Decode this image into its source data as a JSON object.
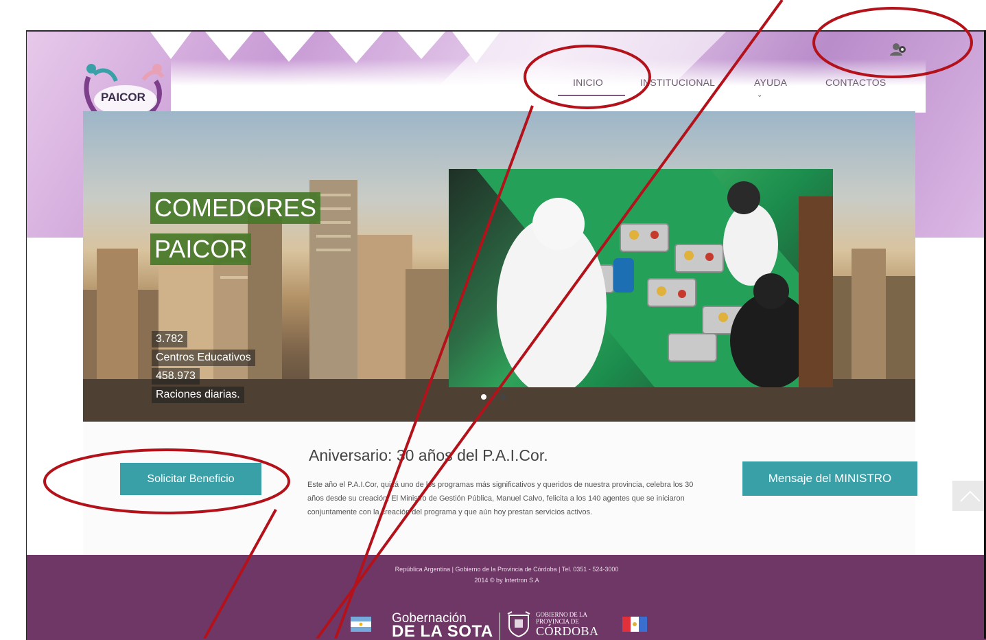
{
  "header": {
    "logo_text": "PAICOR",
    "nav": [
      "INICIO",
      "INSTITUCIONAL",
      "AYUDA",
      "CONTACTOS"
    ],
    "ayuda_chevron": "chevron-down-icon",
    "user_icon": "user-icon"
  },
  "hero": {
    "title_lines": [
      "COMEDORES",
      "PAICOR"
    ],
    "stats": [
      "3.782",
      "Centros Educativos",
      "458.973",
      "Raciones diarias."
    ],
    "slides_count": 3,
    "active_slide": 1
  },
  "content": {
    "solicitar_label": "Solicitar Beneficio",
    "ministro_label": "Mensaje del MINISTRO",
    "news_title": "Aniversario: 30 años del P.A.I.Cor.",
    "news_body": "Este año el P.A.I.Cor, quizá uno de los programas más significativos y queridos de nuestra provincia, celebra los 30 años desde su creación. El Ministro de Gestión Pública, Manuel Calvo, felicita a los 140 agentes que se iniciaron conjuntamente con la creación del programa y que aún hoy prestan servicios activos."
  },
  "footer": {
    "line1": "República Argentina | Gobierno de la Provincia de Córdoba | Tel. 0351 - 524-3000",
    "line2": "2014 © by Intertron S.A",
    "gob_small": "Gobernación",
    "gob_big": "DE LA SOTA",
    "cba_1": "GOBIERNO DE LA",
    "cba_2": "PROVINCIA DE",
    "cba_3": "CÓRDOBA"
  },
  "colors": {
    "teal_button": "#3aa0a8",
    "footer_purple": "#6e3766",
    "annotation_red": "#b3121b"
  }
}
